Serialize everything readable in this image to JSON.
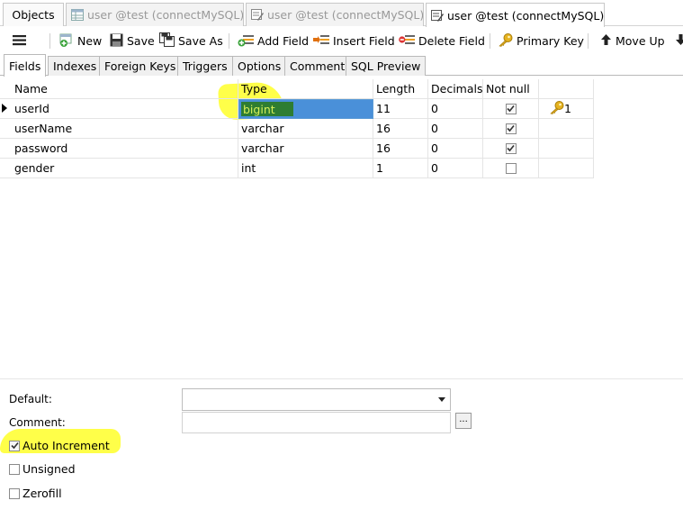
{
  "doc_tabs": {
    "objects": "Objects",
    "tab1": "user @test (connectMySQL)...",
    "tab2": "user @test (connectMySQL)...",
    "tab3": "user @test (connectMySQL)..."
  },
  "toolbar": {
    "new": "New",
    "save": "Save",
    "save_as": "Save As",
    "add_field": "Add Field",
    "insert_field": "Insert Field",
    "delete_field": "Delete Field",
    "primary_key": "Primary Key",
    "move_up": "Move Up"
  },
  "sub_tabs": [
    "Fields",
    "Indexes",
    "Foreign Keys",
    "Triggers",
    "Options",
    "Comment",
    "SQL Preview"
  ],
  "grid": {
    "headers": {
      "name": "Name",
      "type": "Type",
      "length": "Length",
      "decimals": "Decimals",
      "not_null": "Not null"
    },
    "rows": [
      {
        "name": "userId",
        "type": "bigint",
        "length": "11",
        "decimals": "0",
        "not_null": true,
        "key": "1"
      },
      {
        "name": "userName",
        "type": "varchar",
        "length": "16",
        "decimals": "0",
        "not_null": true,
        "key": ""
      },
      {
        "name": "password",
        "type": "varchar",
        "length": "16",
        "decimals": "0",
        "not_null": true,
        "key": ""
      },
      {
        "name": "gender",
        "type": "int",
        "length": "1",
        "decimals": "0",
        "not_null": false,
        "key": ""
      }
    ]
  },
  "props": {
    "default_label": "Default:",
    "default_value": "",
    "comment_label": "Comment:",
    "comment_value": "",
    "dots": "...",
    "auto_increment": {
      "label": "Auto Increment",
      "checked": true
    },
    "unsigned": {
      "label": "Unsigned",
      "checked": false
    },
    "zerofill": {
      "label": "Zerofill",
      "checked": false
    }
  },
  "colors": {
    "highlight": "#ffff3a",
    "selection_blue": "#4a90d9",
    "selection_green": "#2e7d32"
  }
}
